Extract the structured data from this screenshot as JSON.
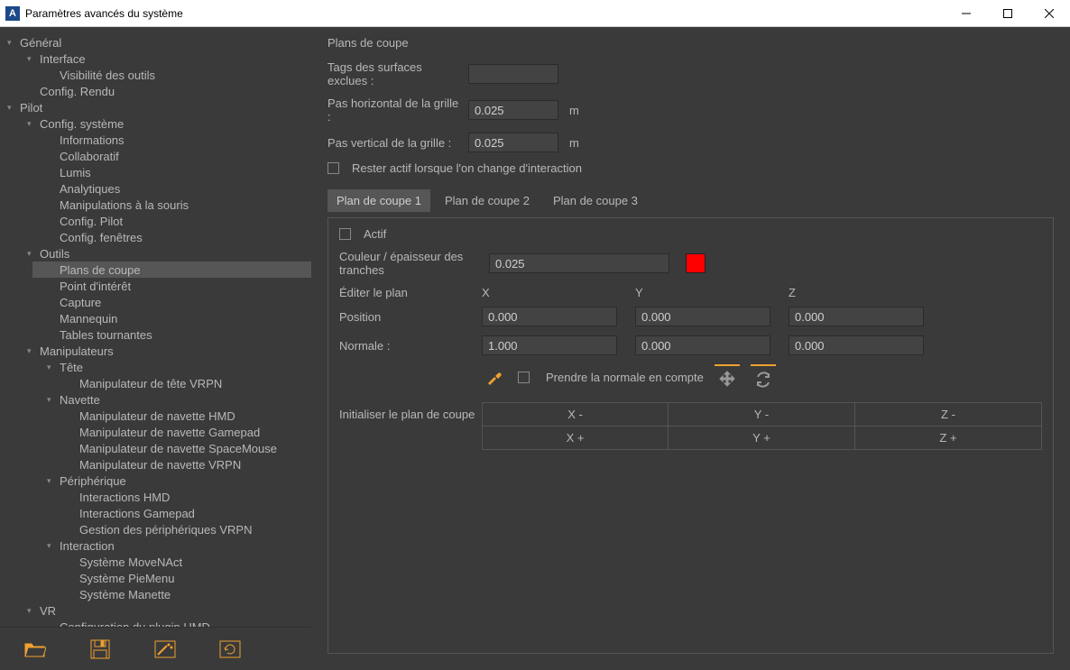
{
  "window": {
    "title": "Paramètres avancés du système",
    "icon_letter": "A"
  },
  "accent_color": "#f0a030",
  "swatch_color": "#ff0000",
  "sidebar": {
    "selected": "Plans de coupe",
    "nodes": [
      {
        "label": "Général",
        "expanded": true,
        "children": [
          {
            "label": "Interface",
            "expanded": true,
            "children": [
              {
                "label": "Visibilité des outils"
              }
            ]
          },
          {
            "label": "Config. Rendu"
          }
        ]
      },
      {
        "label": "Pilot",
        "expanded": true,
        "children": [
          {
            "label": "Config. système",
            "expanded": true,
            "children": [
              {
                "label": "Informations"
              },
              {
                "label": "Collaboratif"
              },
              {
                "label": "Lumis"
              },
              {
                "label": "Analytiques"
              },
              {
                "label": "Manipulations à la souris"
              },
              {
                "label": "Config. Pilot"
              },
              {
                "label": "Config. fenêtres"
              }
            ]
          },
          {
            "label": "Outils",
            "expanded": true,
            "children": [
              {
                "label": "Plans de coupe"
              },
              {
                "label": "Point d'intérêt"
              },
              {
                "label": "Capture"
              },
              {
                "label": "Mannequin"
              },
              {
                "label": "Tables tournantes"
              }
            ]
          },
          {
            "label": "Manipulateurs",
            "expanded": true,
            "children": [
              {
                "label": "Tête",
                "expanded": true,
                "children": [
                  {
                    "label": "Manipulateur de tête VRPN"
                  }
                ]
              },
              {
                "label": "Navette",
                "expanded": true,
                "children": [
                  {
                    "label": "Manipulateur de navette HMD"
                  },
                  {
                    "label": "Manipulateur de navette Gamepad"
                  },
                  {
                    "label": "Manipulateur de navette SpaceMouse"
                  },
                  {
                    "label": "Manipulateur de navette VRPN"
                  }
                ]
              },
              {
                "label": "Périphérique",
                "expanded": true,
                "children": [
                  {
                    "label": "Interactions HMD"
                  },
                  {
                    "label": "Interactions Gamepad"
                  },
                  {
                    "label": "Gestion des périphériques VRPN"
                  }
                ]
              },
              {
                "label": "Interaction",
                "expanded": true,
                "children": [
                  {
                    "label": "Système MoveNAct"
                  },
                  {
                    "label": "Système PieMenu"
                  },
                  {
                    "label": "Système Manette"
                  }
                ]
              }
            ]
          },
          {
            "label": "VR",
            "expanded": true,
            "children": [
              {
                "label": "Configuration du plugin HMD"
              }
            ]
          }
        ]
      }
    ]
  },
  "section": {
    "title": "Plans de coupe",
    "excluded_tags_label": "Tags des surfaces exclues :",
    "excluded_tags_value": "",
    "hstep_label": "Pas horizontal de la grille :",
    "hstep_value": "0.025",
    "vstep_label": "Pas vertical de la grille :",
    "vstep_value": "0.025",
    "unit": "m",
    "stay_active_label": "Rester actif lorsque l'on change d'interaction",
    "tabs": [
      "Plan de coupe 1",
      "Plan de coupe 2",
      "Plan de coupe 3"
    ]
  },
  "plane": {
    "active_label": "Actif",
    "thickness_label": "Couleur / épaisseur des tranches",
    "thickness_value": "0.025",
    "edit_label": "Éditer le plan",
    "axis": {
      "x": "X",
      "y": "Y",
      "z": "Z"
    },
    "position_label": "Position",
    "position": {
      "x": "0.000",
      "y": "0.000",
      "z": "0.000"
    },
    "normal_label": "Normale :",
    "normal": {
      "x": "1.000",
      "y": "0.000",
      "z": "0.000"
    },
    "take_normal_label": "Prendre la normale en compte",
    "init_label": "Initialiser le plan de coupe",
    "init_neg": {
      "x": "X -",
      "y": "Y -",
      "z": "Z -"
    },
    "init_pos": {
      "x": "X +",
      "y": "Y +",
      "z": "Z +"
    }
  },
  "toolbar": {
    "open": "open",
    "save": "save",
    "wand": "wand",
    "reload": "reload"
  }
}
